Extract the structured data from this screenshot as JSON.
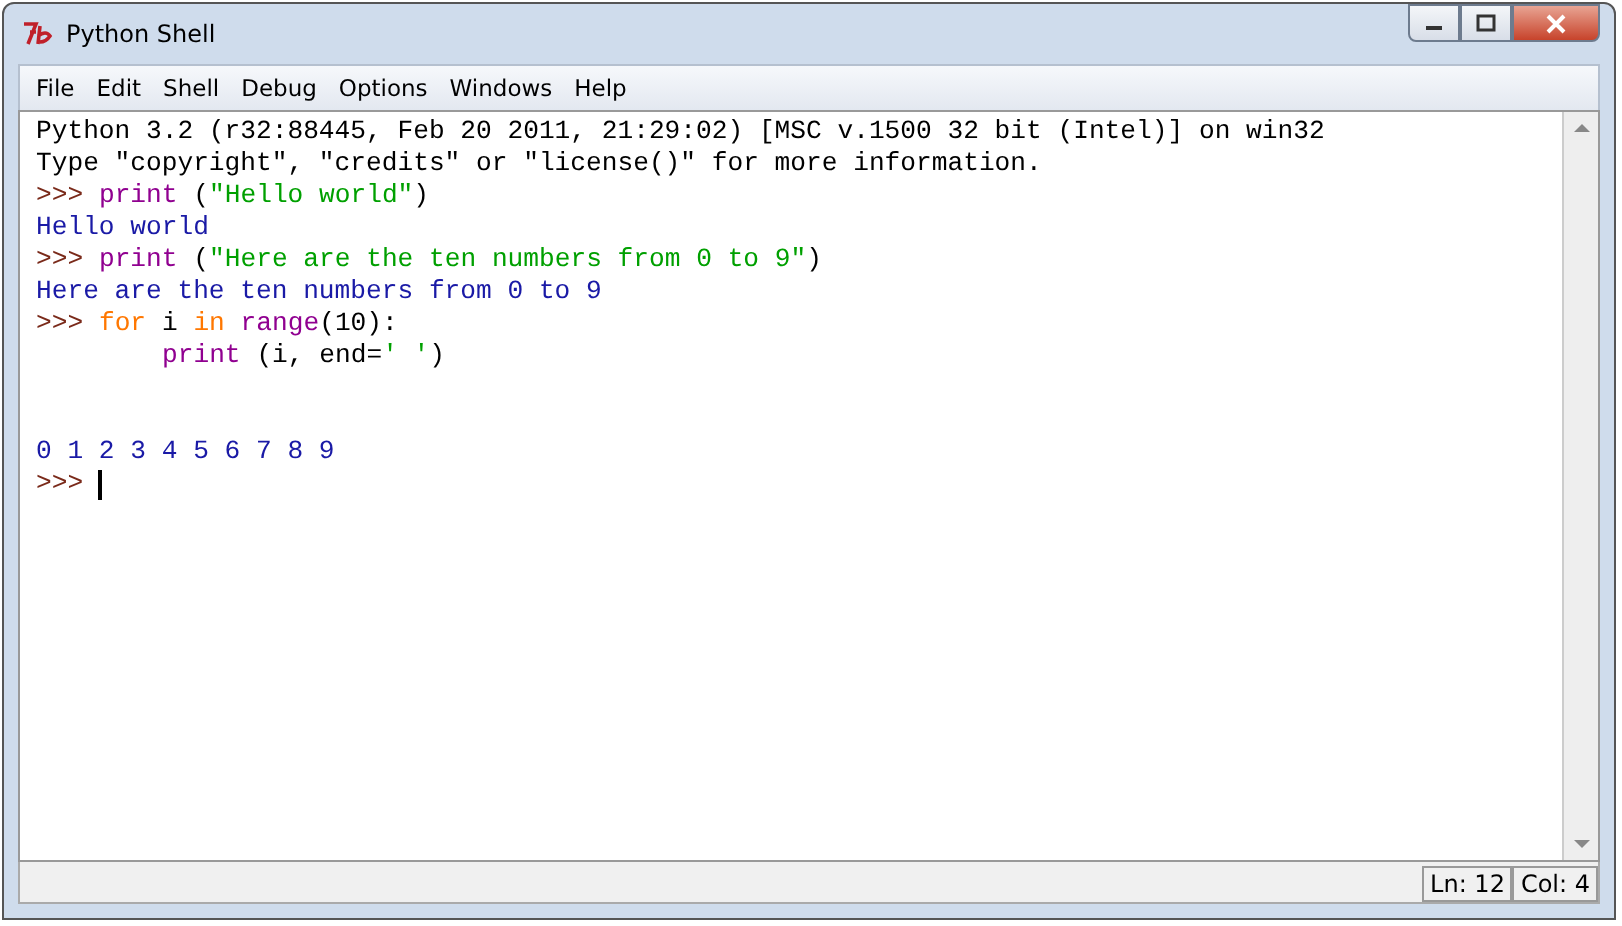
{
  "window": {
    "title": "Python Shell"
  },
  "menu": [
    "File",
    "Edit",
    "Shell",
    "Debug",
    "Options",
    "Windows",
    "Help"
  ],
  "shell": {
    "lines": [
      {
        "kind": "text",
        "segments": [
          {
            "kind": "output",
            "text": "Python 3.2 (r32:88445, Feb 20 2011, 21:29:02) [MSC v.1500 32 bit (Intel)] on win32"
          }
        ]
      },
      {
        "kind": "text",
        "segments": [
          {
            "kind": "output",
            "text": "Type \"copyright\", \"credits\" or \"license()\" for more information."
          }
        ]
      },
      {
        "kind": "text",
        "segments": [
          {
            "kind": "prompt",
            "text": ">>>"
          },
          {
            "kind": "builtin",
            "text": "print"
          },
          {
            "kind": "plain",
            "text": "("
          },
          {
            "kind": "string",
            "text": "\"Hello world\"",
            "joined": true
          },
          {
            "kind": "plain",
            "text": ")",
            "joined": true
          }
        ]
      },
      {
        "kind": "text",
        "segments": [
          {
            "kind": "stdout",
            "text": "Hello world"
          }
        ]
      },
      {
        "kind": "text",
        "segments": [
          {
            "kind": "prompt",
            "text": ">>>"
          },
          {
            "kind": "builtin",
            "text": "print"
          },
          {
            "kind": "plain",
            "text": "("
          },
          {
            "kind": "string",
            "text": "\"Here are the ten numbers from 0 to 9\"",
            "joined": true
          },
          {
            "kind": "plain",
            "text": ")",
            "joined": true
          }
        ]
      },
      {
        "kind": "text",
        "segments": [
          {
            "kind": "stdout",
            "text": "Here are the ten numbers from 0 to 9"
          }
        ]
      },
      {
        "kind": "text",
        "segments": [
          {
            "kind": "prompt",
            "text": ">>>"
          },
          {
            "kind": "keyword",
            "text": "for"
          },
          {
            "kind": "plain",
            "text": "i"
          },
          {
            "kind": "keyword",
            "text": "in"
          },
          {
            "kind": "builtin",
            "text": "range"
          },
          {
            "kind": "plain",
            "text": "(10):",
            "joined": true
          }
        ]
      },
      {
        "kind": "indented",
        "segments": [
          {
            "kind": "builtin",
            "text": "print"
          },
          {
            "kind": "plain",
            "text": "(i, end="
          },
          {
            "kind": "string",
            "text": "' '",
            "joined": true
          },
          {
            "kind": "plain",
            "text": ")",
            "joined": true
          }
        ]
      },
      {
        "kind": "blank"
      },
      {
        "kind": "blank"
      },
      {
        "kind": "text",
        "segments": [
          {
            "kind": "stdout",
            "text": "0 1 2 3 4 5 6 7 8 9"
          }
        ]
      },
      {
        "kind": "text",
        "cursor": true,
        "segments": [
          {
            "kind": "prompt",
            "text": ">>>"
          }
        ]
      }
    ]
  },
  "status_bar": {
    "line": "Ln: 12",
    "column": "Col: 4"
  }
}
